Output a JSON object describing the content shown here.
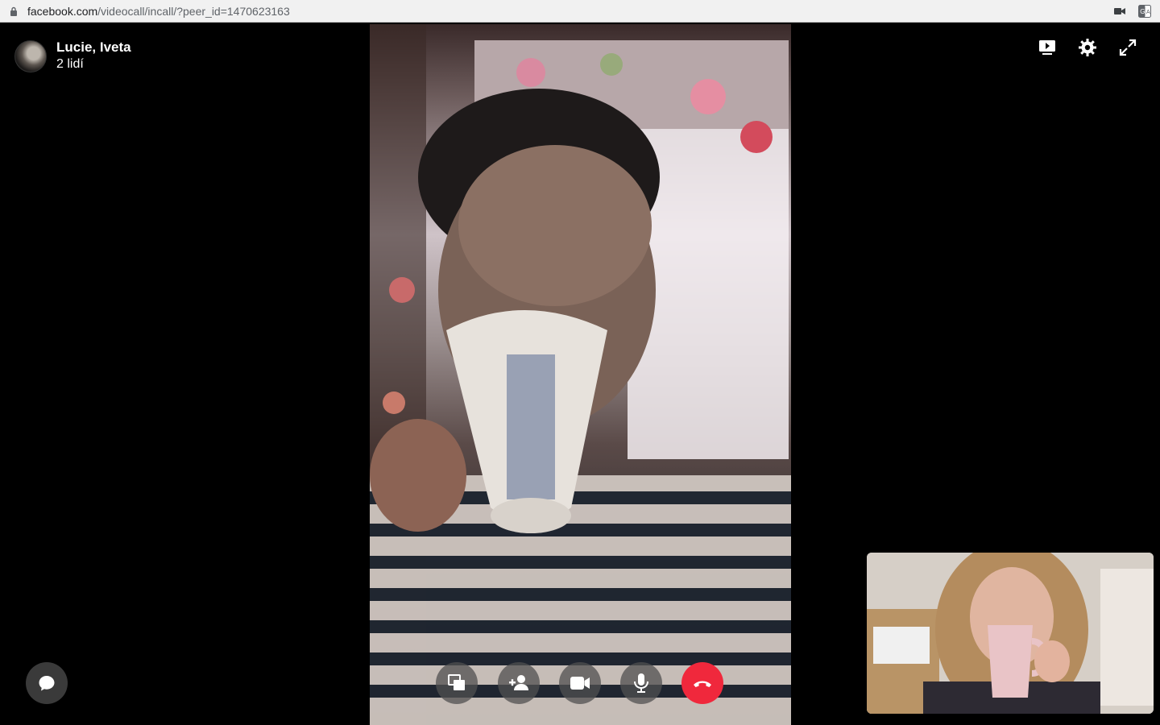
{
  "browser": {
    "url_host": "facebook.com",
    "url_path": "/videocall/incall/?peer_id=1470623163",
    "icons": [
      "lock-icon",
      "camera-indicator-icon",
      "translate-icon"
    ]
  },
  "call": {
    "title": "Lucie, Iveta",
    "subtitle": "2 lidí",
    "top_icons": [
      "screen-present-icon",
      "settings-gear-icon",
      "fullscreen-expand-icon"
    ],
    "controls": [
      {
        "name": "share-screen-button",
        "icon": "windows-icon"
      },
      {
        "name": "add-person-button",
        "icon": "add-person-icon"
      },
      {
        "name": "video-toggle-button",
        "icon": "video-camera-icon"
      },
      {
        "name": "mute-button",
        "icon": "microphone-icon"
      },
      {
        "name": "end-call-button",
        "icon": "phone-hangup-icon"
      }
    ],
    "chat_icon": "chat-bubble-icon",
    "colors": {
      "end_call": "#f0283c",
      "control_bg": "#505050",
      "background": "#000000"
    }
  }
}
